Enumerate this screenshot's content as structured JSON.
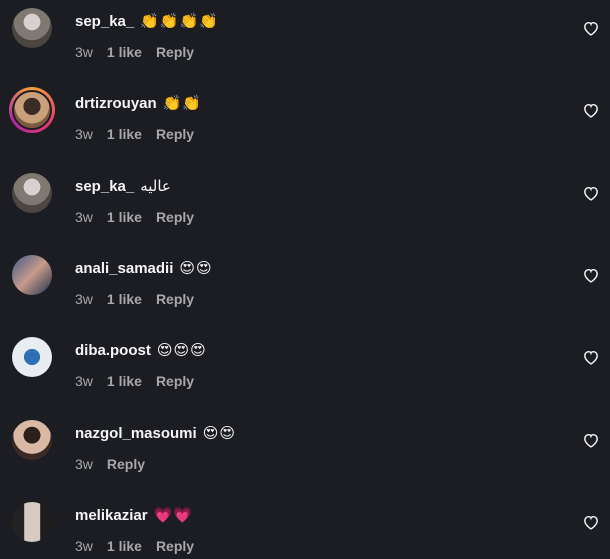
{
  "comments": [
    {
      "username": "sep_ka_",
      "text": "",
      "emoji": "👏👏👏👏",
      "time": "3w",
      "likes": "1 like",
      "reply": "Reply",
      "avatar": "av1",
      "story": false
    },
    {
      "username": "drtizrouyan",
      "text": "",
      "emoji": "👏👏",
      "time": "3w",
      "likes": "1 like",
      "reply": "Reply",
      "avatar": "av2",
      "story": true
    },
    {
      "username": "sep_ka_",
      "text": "عالیه",
      "emoji": "",
      "time": "3w",
      "likes": "1 like",
      "reply": "Reply",
      "avatar": "av1",
      "story": false
    },
    {
      "username": "anali_samadii",
      "text": "",
      "emoji": "😍😍",
      "time": "3w",
      "likes": "1 like",
      "reply": "Reply",
      "avatar": "av3",
      "story": false
    },
    {
      "username": "diba.poost",
      "text": "",
      "emoji": "😍😍😍",
      "time": "3w",
      "likes": "1 like",
      "reply": "Reply",
      "avatar": "av4",
      "story": false
    },
    {
      "username": "nazgol_masoumi",
      "text": "",
      "emoji": "😍😍",
      "time": "3w",
      "likes": "",
      "reply": "Reply",
      "avatar": "av5",
      "story": false
    },
    {
      "username": "melikaziar",
      "text": "",
      "emoji": "💗💗",
      "time": "3w",
      "likes": "1 like",
      "reply": "Reply",
      "avatar": "av6",
      "story": false
    }
  ]
}
